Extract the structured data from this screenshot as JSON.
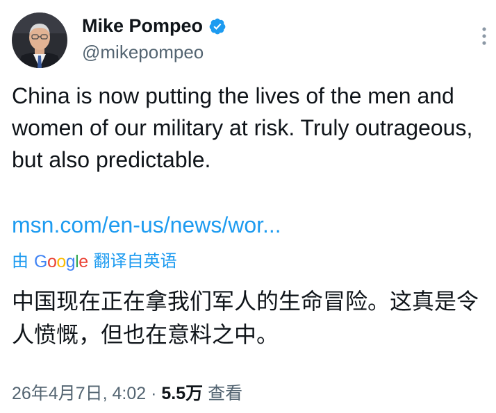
{
  "author": {
    "name": "Mike Pompeo",
    "handle": "@mikepompeo",
    "verified_color": "#1d9bf0"
  },
  "tweet": {
    "text": "China is now putting the lives of the men and women of our military at risk. Truly outrageous, but also predictable.",
    "link": "msn.com/en-us/news/wor..."
  },
  "translation": {
    "prefix": "由",
    "provider": "Google",
    "suffix": "翻译自英语",
    "text": "中国现在正在拿我们军人的生命冒险。这真是令人愤慨，但也在意料之中。"
  },
  "meta": {
    "timestamp": "26年4月7日, 4:02",
    "separator": "·",
    "views": "5.5万",
    "views_label": "查看"
  },
  "colors": {
    "link": "#1d9bf0",
    "secondary_text": "#536471",
    "primary_text": "#0f1419"
  },
  "icons": {
    "verified": "verified-badge-icon",
    "more": "more-options-icon"
  }
}
